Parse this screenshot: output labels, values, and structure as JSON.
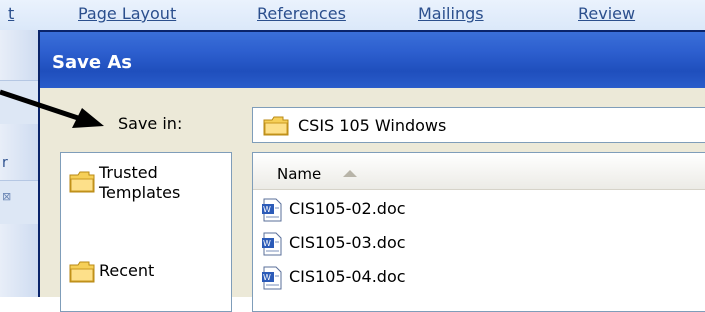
{
  "ribbon": {
    "tabs": [
      "t",
      "Page Layout",
      "References",
      "Mailings",
      "Review"
    ]
  },
  "background_left": {
    "texts": [
      "r",
      "⊠"
    ]
  },
  "dialog": {
    "title": "Save As",
    "save_in_label": "Save in:",
    "save_in_value": "CSIS 105 Windows",
    "places": [
      {
        "label_line1": "Trusted",
        "label_line2": "Templates"
      },
      {
        "label_line1": "Recent",
        "label_line2": ""
      }
    ],
    "file_list": {
      "column_name": "Name",
      "files": [
        "CIS105-02.doc",
        "CIS105-03.doc",
        "CIS105-04.doc"
      ]
    }
  },
  "colors": {
    "titlebar": "#2d5fcf",
    "dialog_bg": "#ece9d8",
    "ribbon_text": "#2b4f8d"
  },
  "icons": [
    "folder-icon",
    "word-doc-icon",
    "annotation-arrow-icon",
    "sort-up-icon"
  ]
}
